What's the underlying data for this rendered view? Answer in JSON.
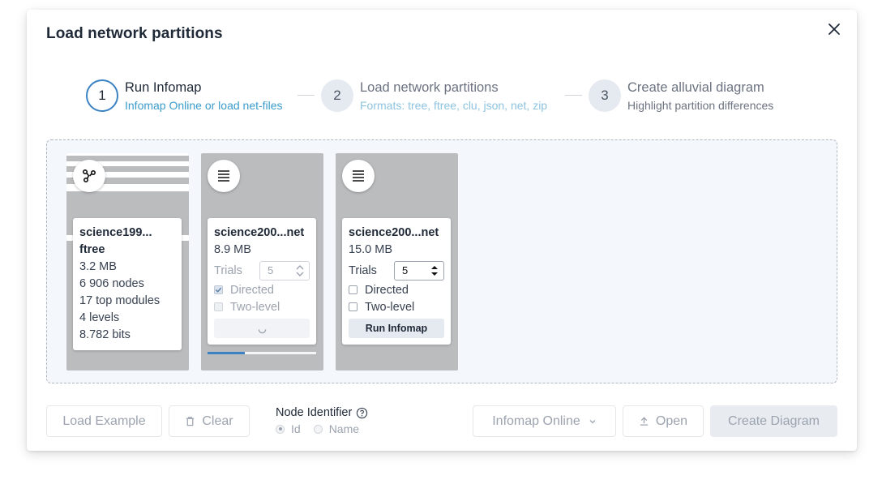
{
  "modal": {
    "title": "Load network partitions"
  },
  "steps": [
    {
      "number": "1",
      "title": "Run Infomap",
      "subtitle": "Infomap Online or load net-files"
    },
    {
      "number": "2",
      "title": "Load network partitions",
      "subtitle": "Formats: tree, ftree, clu, json, net, zip"
    },
    {
      "number": "3",
      "title": "Create alluvial diagram",
      "subtitle": "Highlight partition differences"
    }
  ],
  "files": [
    {
      "icon": "network-icon",
      "name_line1": "science199...",
      "name_line2": "ftree",
      "size": "3.2 MB",
      "nodes": "6 906 nodes",
      "modules": "17 top modules",
      "levels": "4 levels",
      "codelength": "8.782 bits"
    },
    {
      "icon": "text-lines-icon",
      "name": "science200...net",
      "size": "8.9 MB",
      "trials_label": "Trials",
      "trials_value": "5",
      "directed_label": "Directed",
      "directed_checked": true,
      "twolevel_label": "Two-level",
      "twolevel_checked": false,
      "progress": 0.34
    },
    {
      "icon": "text-lines-icon",
      "name": "science200...net",
      "size": "15.0 MB",
      "trials_label": "Trials",
      "trials_value": "5",
      "directed_label": "Directed",
      "directed_checked": false,
      "twolevel_label": "Two-level",
      "twolevel_checked": false,
      "run_label": "Run Infomap"
    }
  ],
  "footer": {
    "load_example": "Load Example",
    "clear": "Clear",
    "node_identifier_label": "Node Identifier",
    "node_identifier_options": [
      "Id",
      "Name"
    ],
    "node_identifier_selected": "Id",
    "infomap_online": "Infomap Online",
    "open": "Open",
    "create_diagram": "Create Diagram"
  },
  "colors": {
    "accent": "#3b82c4",
    "step_subtitle": "#3b9ccb",
    "card_bg": "#bbbcbe",
    "dropzone_bg": "#f4f8fc"
  }
}
